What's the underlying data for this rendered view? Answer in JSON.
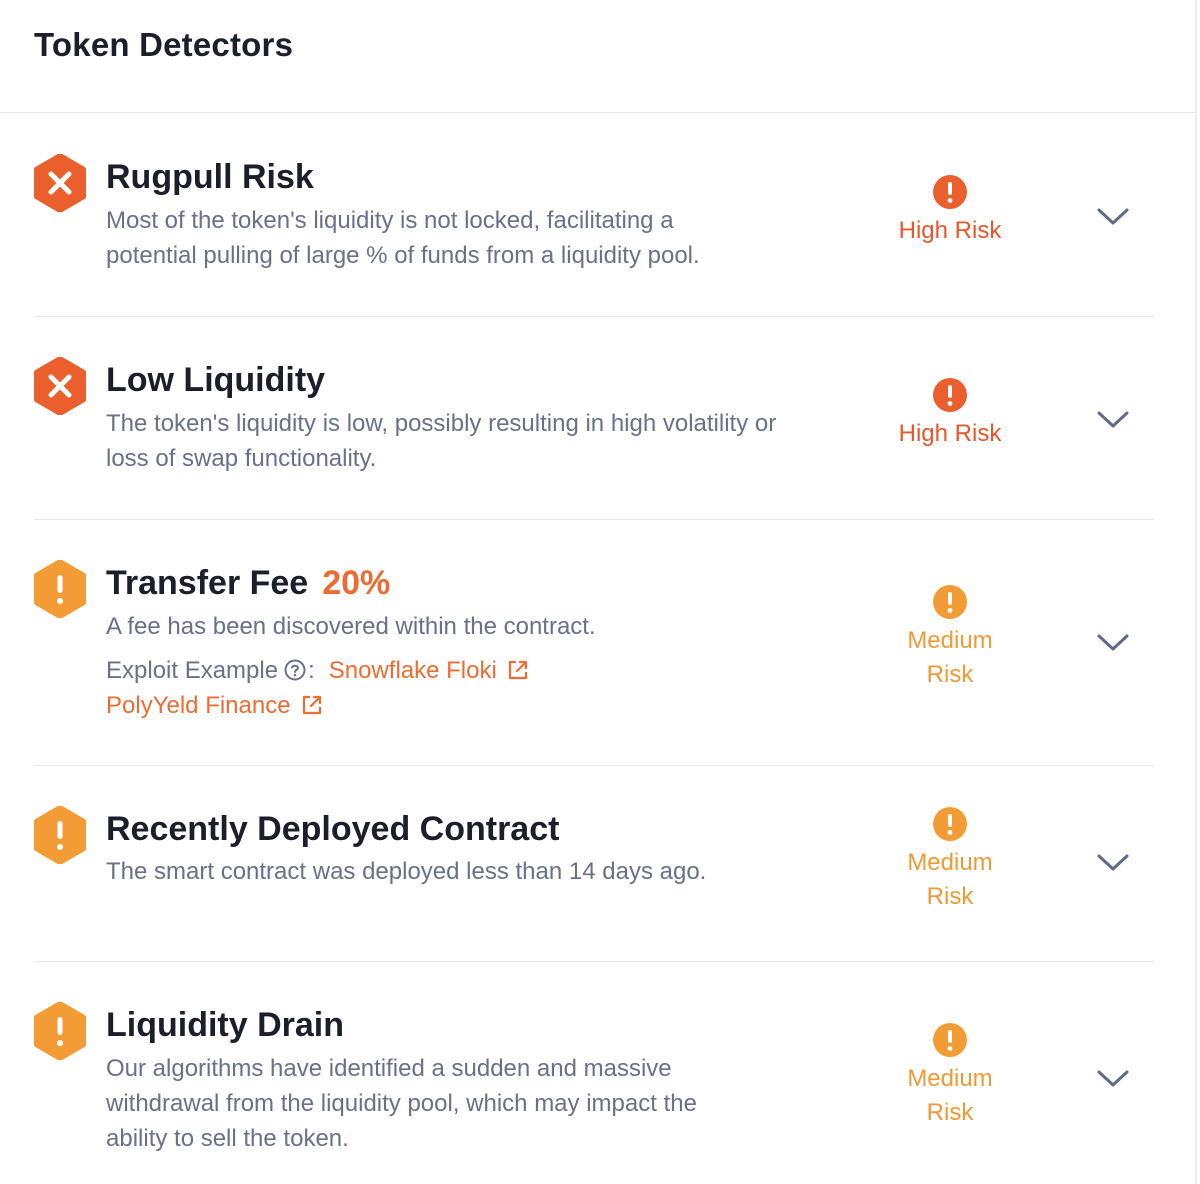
{
  "colors": {
    "high": "#eb5f2d",
    "medium": "#f39c35",
    "title": "#1b1f2b",
    "description": "#687188",
    "link": "#ee6b32",
    "chevron": "#5f6b84"
  },
  "header": {
    "title": "Token Detectors"
  },
  "detectors": [
    {
      "title": "Rugpull Risk",
      "severity": "high",
      "icon": "x-hexagon-icon",
      "description": "Most of the token's liquidity is not locked, facilitating a potential pulling of large % of funds from a liquidity pool.",
      "risk_label": "High Risk"
    },
    {
      "title": "Low Liquidity",
      "severity": "high",
      "icon": "x-hexagon-icon",
      "description": "The token's liquidity is low, possibly resulting in high volatility or loss of swap functionality.",
      "risk_label": "High Risk"
    },
    {
      "title": "Transfer Fee",
      "title_extra": "20%",
      "severity": "medium",
      "icon": "exclamation-hexagon-icon",
      "description": "A fee has been discovered within the contract.",
      "exploit_label": "Exploit Example",
      "exploit_colon": ":",
      "exploit_links": [
        "Snowflake Floki",
        "PolyYeld Finance"
      ],
      "risk_label": "Medium Risk"
    },
    {
      "title": "Recently Deployed Contract",
      "severity": "medium",
      "icon": "exclamation-hexagon-icon",
      "description": "The smart contract was deployed less than 14 days ago.",
      "risk_label": "Medium Risk"
    },
    {
      "title": "Liquidity Drain",
      "severity": "medium",
      "icon": "exclamation-hexagon-icon",
      "description": "Our algorithms have identified a sudden and massive withdrawal from the liquidity pool, which may impact the ability to sell the token.",
      "risk_label": "Medium Risk"
    }
  ]
}
